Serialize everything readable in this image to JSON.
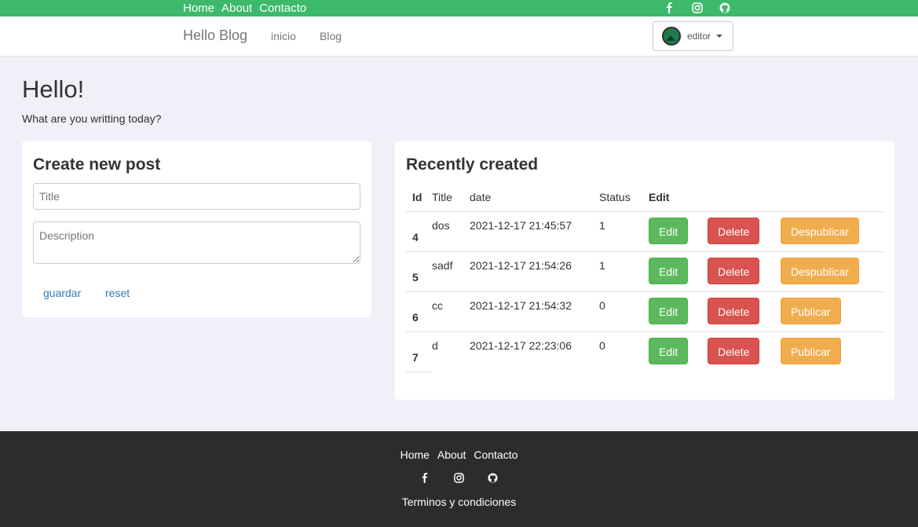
{
  "topbar": {
    "links": [
      "Home",
      "About",
      "Contacto"
    ],
    "social": [
      "facebook-icon",
      "instagram-icon",
      "github-icon"
    ]
  },
  "navbar": {
    "brand": "Hello Blog",
    "links": [
      "inicio",
      "Blog"
    ],
    "user": "editor"
  },
  "hero": {
    "title": "Hello!",
    "subtitle": "What are you writting today?"
  },
  "create": {
    "heading": "Create new post",
    "title_placeholder": "Title",
    "description_placeholder": "Description",
    "save_label": "guardar",
    "reset_label": "reset"
  },
  "recent": {
    "heading": "Recently created",
    "columns": [
      "Id",
      "Title",
      "date",
      "Status",
      "Edit"
    ],
    "rows": [
      {
        "id": "4",
        "title": "dos",
        "date": "2021-12-17 21:45:57",
        "status": "1",
        "edit": "Edit",
        "delete": "Delete",
        "publish": "Despublicar"
      },
      {
        "id": "5",
        "title": "sadf",
        "date": "2021-12-17 21:54:26",
        "status": "1",
        "edit": "Edit",
        "delete": "Delete",
        "publish": "Despublicar"
      },
      {
        "id": "6",
        "title": "cc",
        "date": "2021-12-17 21:54:32",
        "status": "0",
        "edit": "Edit",
        "delete": "Delete",
        "publish": "Publicar"
      },
      {
        "id": "7",
        "title": "d",
        "date": "2021-12-17 22:23:06",
        "status": "0",
        "edit": "Edit",
        "delete": "Delete",
        "publish": "Publicar"
      }
    ]
  },
  "footer": {
    "links": [
      "Home",
      "About",
      "Contacto"
    ],
    "social": [
      "facebook-icon",
      "instagram-icon",
      "github-icon"
    ],
    "terms": "Terminos y condiciones"
  },
  "colors": {
    "topbar": "#3cb96a",
    "footer": "#2c2c2c",
    "background": "#eff0f8",
    "edit": "#5cb85c",
    "delete": "#d9534f",
    "publish": "#f0ad4e",
    "link": "#337ab7"
  }
}
